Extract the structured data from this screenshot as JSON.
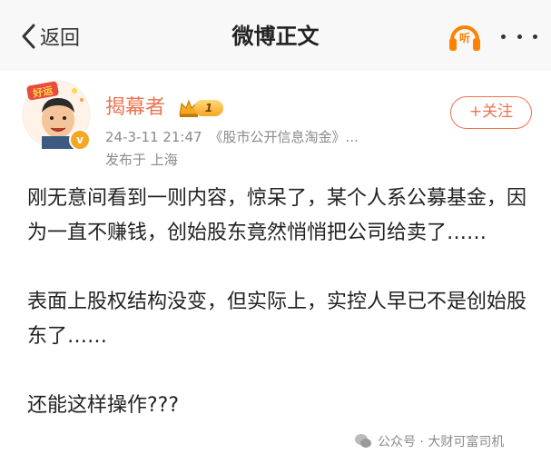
{
  "header": {
    "back_label": "返回",
    "title": "微博正文",
    "listen_label": "听"
  },
  "author": {
    "name": "揭幕者",
    "level": "1",
    "avatar_badge": "v",
    "avatar_sticker": "好运",
    "follow_label": "+关注",
    "time": "24-3-11 21:47",
    "source": "《股市公开信息淘金》...",
    "location": "发布于 上海"
  },
  "post": {
    "paragraphs": [
      "刚无意间看到一则内容，惊呆了，某个人系公募基金，因为一直不赚钱，创始股东竟然悄悄把公司给卖了……",
      "表面上股权结构没变，但实际上，实控人早已不是创始股东了……",
      "还能这样操作???"
    ]
  },
  "watermark": {
    "text": "公众号 · 大财可富司机"
  },
  "colors": {
    "accent": "#eb7350",
    "brand_orange": "#ff8200",
    "meta_gray": "#8a8a8a"
  }
}
